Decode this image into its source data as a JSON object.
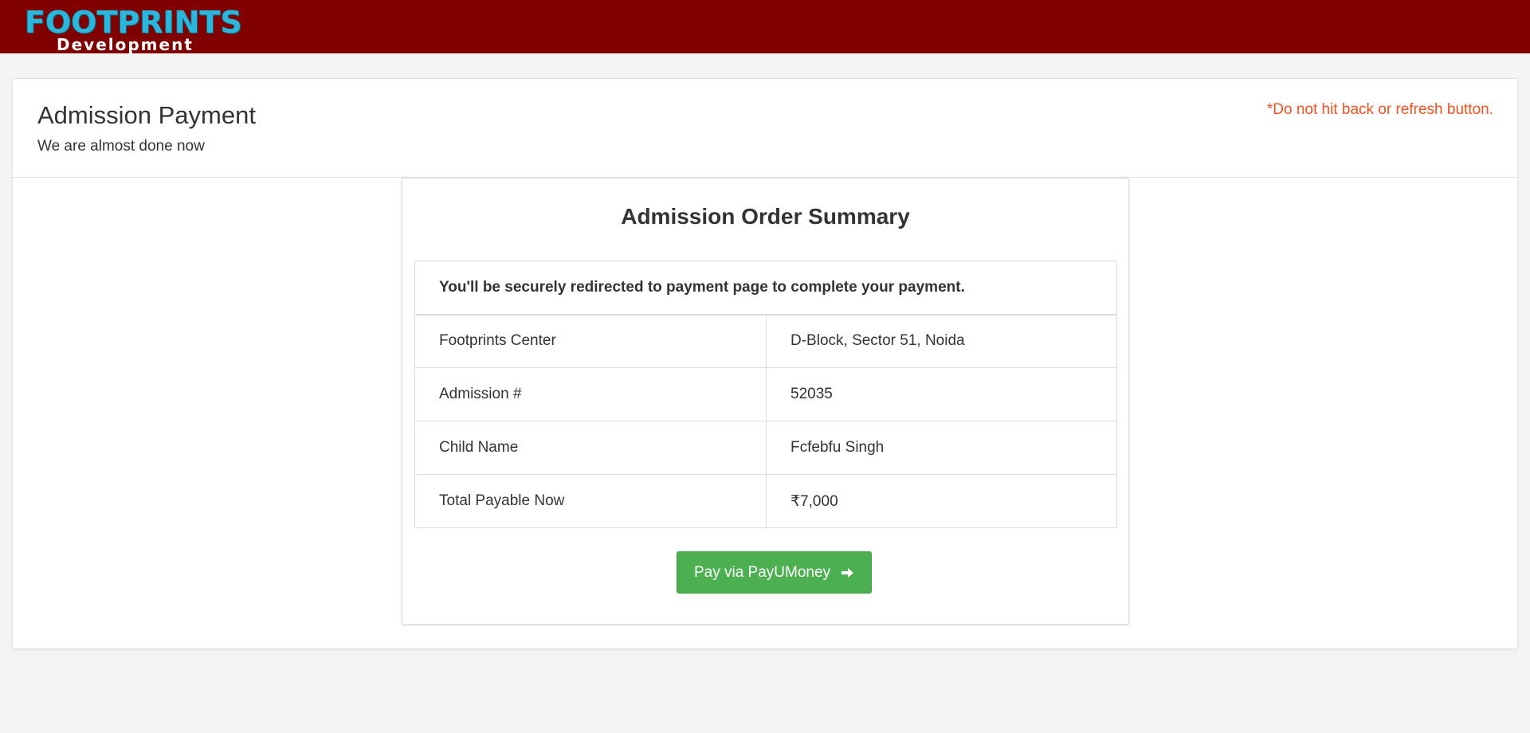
{
  "header": {
    "logo_main": "FOOTPRINTS",
    "logo_sub": "Development",
    "brand_color": "#800000",
    "logo_color": "#2bb6dc"
  },
  "page": {
    "title": "Admission Payment",
    "subtitle": "We are almost done now",
    "warning": "*Do not hit back or refresh button.",
    "warning_color": "#f4511e"
  },
  "summary": {
    "title": "Admission Order Summary",
    "notice": "You'll be securely redirected to payment page to complete your payment.",
    "rows": [
      {
        "label": "Footprints Center",
        "value": "D-Block, Sector 51, Noida"
      },
      {
        "label": "Admission #",
        "value": "52035"
      },
      {
        "label": "Child Name",
        "value": "Fcfebfu Singh"
      },
      {
        "label": "Total Payable Now",
        "value": "₹7,000"
      }
    ],
    "pay_button": "Pay via PayUMoney",
    "pay_button_icon": "arrow-right-icon",
    "button_color": "#4caf50"
  }
}
